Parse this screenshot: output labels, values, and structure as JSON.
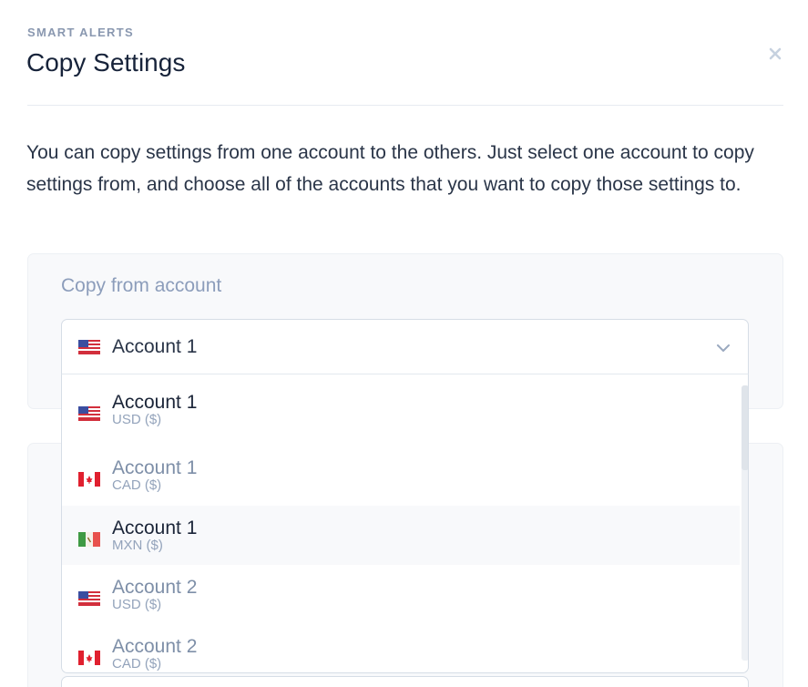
{
  "header": {
    "eyebrow": "SMART ALERTS",
    "title": "Copy Settings",
    "close_icon": "close-icon"
  },
  "intro": "You can copy settings from one account to the others. Just select one account to copy settings from, and choose all of the accounts that you want to copy those settings to.",
  "copy_from": {
    "label": "Copy from account",
    "selected": {
      "name": "Account 1",
      "flag": "us-flag-icon"
    },
    "chevron_icon": "chevron-down-icon"
  },
  "dropdown": {
    "options": [
      {
        "name": "Account 1",
        "currency": "USD ($)",
        "flag": "us-flag-icon",
        "state": "selected"
      },
      {
        "name": "Account 1",
        "currency": "CAD ($)",
        "flag": "ca-flag-icon",
        "state": "default"
      },
      {
        "name": "Account 1",
        "currency": "MXN ($)",
        "flag": "mx-flag-icon",
        "state": "hover"
      },
      {
        "name": "Account 2",
        "currency": "USD ($)",
        "flag": "us-flag-icon",
        "state": "default"
      },
      {
        "name": "Account 2",
        "currency": "CAD ($)",
        "flag": "ca-flag-icon",
        "state": "default"
      }
    ]
  },
  "colors": {
    "text_dark": "#1b2538",
    "text_muted": "#7e8fa8",
    "label": "#8c9dbb",
    "panel_bg": "#f8f9fb",
    "border": "#d6dde6"
  }
}
